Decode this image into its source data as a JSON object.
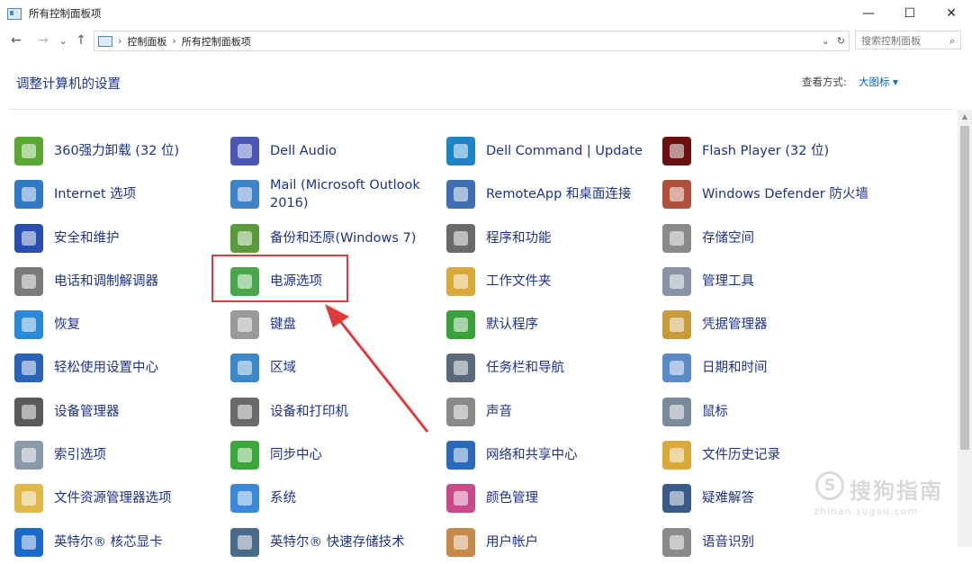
{
  "window": {
    "title": "所有控制面板项"
  },
  "window_controls": {
    "minimize": "—",
    "maximize": "☐",
    "close": "✕"
  },
  "nav": {
    "back": "←",
    "forward": "→",
    "recent": "⌄",
    "up": "↑"
  },
  "address": {
    "crumbs": [
      "控制面板",
      "所有控制面板项"
    ],
    "dropdown": "⌄",
    "refresh": "↻"
  },
  "search": {
    "placeholder": "搜索控制面板",
    "icon": "search-icon"
  },
  "header": {
    "title": "调整计算机的设置",
    "view_by_label": "查看方式:",
    "view_by_value": "大图标 ▾"
  },
  "items": [
    {
      "label": "360强力卸载 (32 位)",
      "icon": "uninstall-icon",
      "color": "#5aa832"
    },
    {
      "label": "Dell Audio",
      "icon": "audio-wave-icon",
      "color": "#4b57b5"
    },
    {
      "label": "Dell Command | Update",
      "icon": "dell-update-icon",
      "color": "#1d84c6"
    },
    {
      "label": "Flash Player (32 位)",
      "icon": "flash-icon",
      "color": "#6a1010"
    },
    {
      "label": "Internet 选项",
      "icon": "globe-icon",
      "color": "#2f78c4"
    },
    {
      "label": "Mail (Microsoft Outlook 2016)",
      "icon": "mail-icon",
      "color": "#3c82c6"
    },
    {
      "label": "RemoteApp 和桌面连接",
      "icon": "remote-desktop-icon",
      "color": "#3f6fb2"
    },
    {
      "label": "Windows Defender 防火墙",
      "icon": "firewall-icon",
      "color": "#b0503a"
    },
    {
      "label": "安全和维护",
      "icon": "flag-icon",
      "color": "#284fb0"
    },
    {
      "label": "备份和还原(Windows 7)",
      "icon": "backup-icon",
      "color": "#5a9a3a"
    },
    {
      "label": "程序和功能",
      "icon": "programs-icon",
      "color": "#6a6a6a"
    },
    {
      "label": "存储空间",
      "icon": "storage-icon",
      "color": "#8a8a8a"
    },
    {
      "label": "电话和调制解调器",
      "icon": "phone-icon",
      "color": "#7a7a7a"
    },
    {
      "label": "电源选项",
      "icon": "battery-icon",
      "color": "#4aa64a"
    },
    {
      "label": "工作文件夹",
      "icon": "work-folder-icon",
      "color": "#d9a93a"
    },
    {
      "label": "管理工具",
      "icon": "admin-tools-icon",
      "color": "#8894a6"
    },
    {
      "label": "恢复",
      "icon": "recovery-icon",
      "color": "#2a88d8"
    },
    {
      "label": "键盘",
      "icon": "keyboard-icon",
      "color": "#9a9a9a"
    },
    {
      "label": "默认程序",
      "icon": "default-programs-icon",
      "color": "#3aa03a"
    },
    {
      "label": "凭据管理器",
      "icon": "credential-icon",
      "color": "#c79a3a"
    },
    {
      "label": "轻松使用设置中心",
      "icon": "accessibility-icon",
      "color": "#2a62b8"
    },
    {
      "label": "区域",
      "icon": "region-icon",
      "color": "#3a88c8"
    },
    {
      "label": "任务栏和导航",
      "icon": "taskbar-icon",
      "color": "#5a6a7a"
    },
    {
      "label": "日期和时间",
      "icon": "calendar-icon",
      "color": "#5a8ac8"
    },
    {
      "label": "设备管理器",
      "icon": "device-manager-icon",
      "color": "#5a5a5a"
    },
    {
      "label": "设备和打印机",
      "icon": "printer-icon",
      "color": "#6a6a6a"
    },
    {
      "label": "声音",
      "icon": "speaker-icon",
      "color": "#8a8a8a"
    },
    {
      "label": "鼠标",
      "icon": "mouse-icon",
      "color": "#7a8a9a"
    },
    {
      "label": "索引选项",
      "icon": "index-icon",
      "color": "#8a9aaa"
    },
    {
      "label": "同步中心",
      "icon": "sync-icon",
      "color": "#3aa83a"
    },
    {
      "label": "网络和共享中心",
      "icon": "network-icon",
      "color": "#2a6ab8"
    },
    {
      "label": "文件历史记录",
      "icon": "file-history-icon",
      "color": "#d9a93a"
    },
    {
      "label": "文件资源管理器选项",
      "icon": "folder-options-icon",
      "color": "#e0b84a"
    },
    {
      "label": "系统",
      "icon": "system-icon",
      "color": "#3a8ad8"
    },
    {
      "label": "颜色管理",
      "icon": "color-management-icon",
      "color": "#c84a8a"
    },
    {
      "label": "疑难解答",
      "icon": "troubleshoot-icon",
      "color": "#3a5a8a"
    },
    {
      "label": "英特尔® 核芯显卡",
      "icon": "intel-graphics-icon",
      "color": "#1a6ac8"
    },
    {
      "label": "英特尔® 快速存储技术",
      "icon": "intel-storage-icon",
      "color": "#4a6a8a"
    },
    {
      "label": "用户帐户",
      "icon": "user-accounts-icon",
      "color": "#c88a4a"
    },
    {
      "label": "语音识别",
      "icon": "microphone-icon",
      "color": "#8a8a8a"
    }
  ],
  "watermark": {
    "brand": "搜狗指南",
    "url": "zhinan.sogou.com",
    "logo_glyph": "S"
  },
  "colors": {
    "link": "#1e3287",
    "highlight_border": "#e03a3a",
    "arrow": "#e03a3a"
  }
}
